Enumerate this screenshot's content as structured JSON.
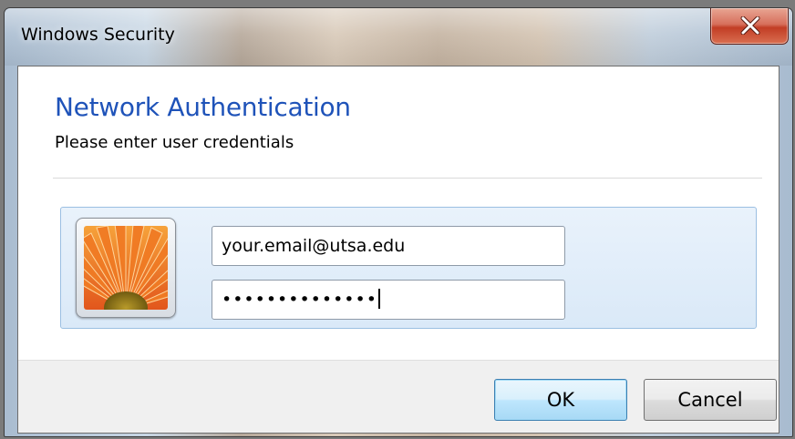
{
  "window": {
    "title": "Windows Security",
    "close_icon": "close-icon"
  },
  "dialog": {
    "heading": "Network Authentication",
    "subheading": "Please enter user credentials"
  },
  "credentials": {
    "avatar_icon": "user-tile-flower",
    "username_value": "your.email@utsa.edu",
    "password_masked": "••••••••••••••"
  },
  "buttons": {
    "ok_label": "OK",
    "cancel_label": "Cancel"
  },
  "colors": {
    "heading": "#1f53b9",
    "tile_border": "#9bbfe2",
    "tile_background": "#dae9f8",
    "close_button": "#c23d25",
    "default_button_border": "#3c7fb1"
  }
}
